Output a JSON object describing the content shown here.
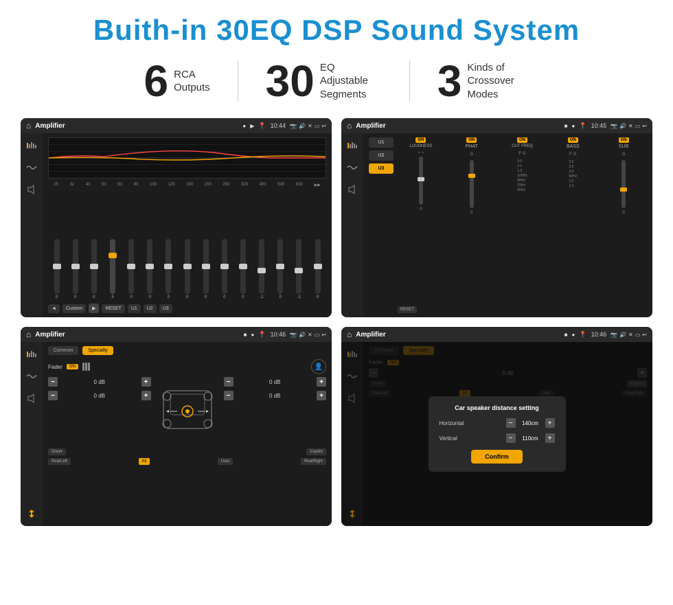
{
  "title": "Buith-in 30EQ DSP Sound System",
  "stats": [
    {
      "number": "6",
      "label_line1": "RCA",
      "label_line2": "Outputs"
    },
    {
      "number": "30",
      "label_line1": "EQ Adjustable",
      "label_line2": "Segments"
    },
    {
      "number": "3",
      "label_line1": "Kinds of",
      "label_line2": "Crossover Modes"
    }
  ],
  "screens": [
    {
      "id": "eq-screen",
      "bar": {
        "title": "Amplifier",
        "time": "10:44"
      },
      "type": "eq"
    },
    {
      "id": "crossover-screen",
      "bar": {
        "title": "Amplifier",
        "time": "10:45"
      },
      "type": "crossover"
    },
    {
      "id": "fader-screen",
      "bar": {
        "title": "Amplifier",
        "time": "10:46"
      },
      "type": "fader"
    },
    {
      "id": "dialog-screen",
      "bar": {
        "title": "Amplifier",
        "time": "10:46"
      },
      "type": "dialog"
    }
  ],
  "eq": {
    "freqs": [
      "25",
      "32",
      "40",
      "50",
      "63",
      "80",
      "100",
      "125",
      "160",
      "200",
      "250",
      "320",
      "400",
      "500",
      "630"
    ],
    "values": [
      "0",
      "0",
      "0",
      "5",
      "0",
      "0",
      "0",
      "0",
      "0",
      "0",
      "0",
      "-1",
      "0",
      "-1",
      "0"
    ],
    "bottom_buttons": [
      "◄",
      "Custom",
      "▶",
      "RESET",
      "U1",
      "U2",
      "U3"
    ]
  },
  "crossover": {
    "presets": [
      "U1",
      "U2",
      "U3"
    ],
    "channels": [
      "LOUDNESS",
      "PHAT",
      "CUT FREQ",
      "BASS",
      "SUB"
    ],
    "reset_label": "RESET"
  },
  "fader": {
    "tabs": [
      "Common",
      "Specialty"
    ],
    "fader_label": "Fader",
    "on_label": "ON",
    "db_values": [
      "0 dB",
      "0 dB",
      "0 dB",
      "0 dB"
    ],
    "buttons": [
      "Driver",
      "RearLeft",
      "All",
      "User",
      "RearRight",
      "Copilot"
    ]
  },
  "dialog": {
    "title": "Car speaker distance setting",
    "horizontal_label": "Horizontal",
    "horizontal_value": "140cm",
    "vertical_label": "Vertical",
    "vertical_value": "110cm",
    "confirm_label": "Confirm"
  }
}
